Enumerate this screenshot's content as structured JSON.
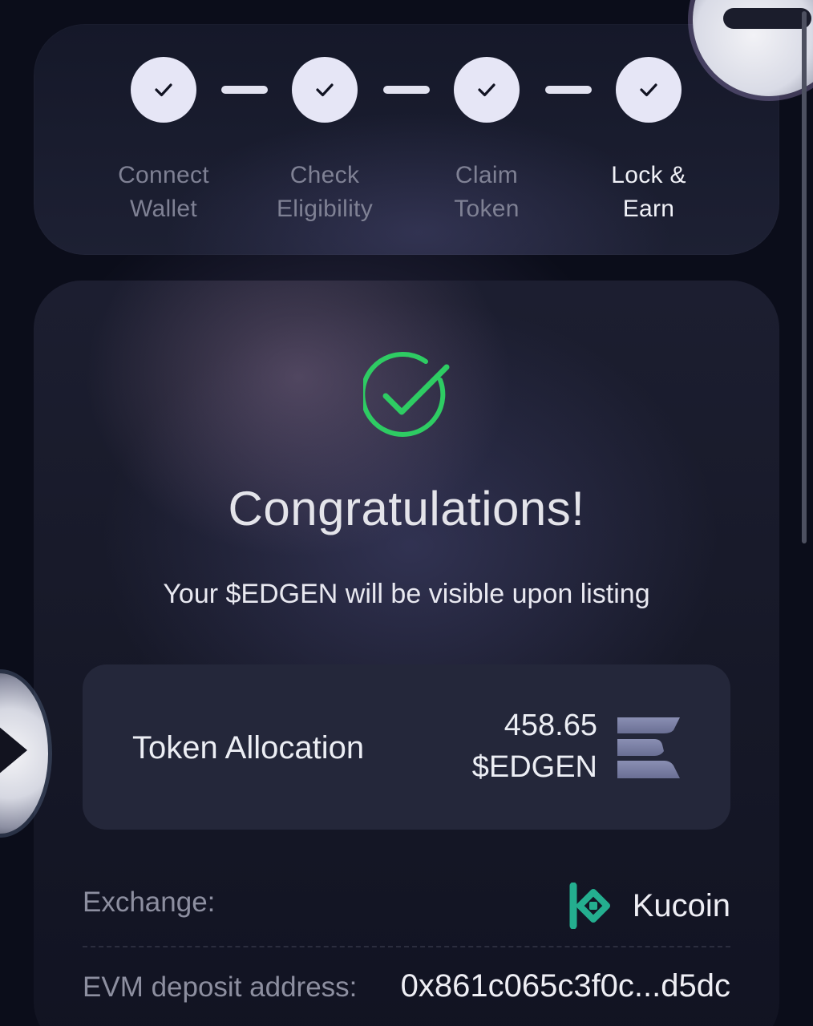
{
  "steps": [
    {
      "label": "Connect\nWallet",
      "icon": "checkmark-icon",
      "state": "complete"
    },
    {
      "label": "Check\nEligibility",
      "icon": "checkmark-icon",
      "state": "complete"
    },
    {
      "label": "Claim\nToken",
      "icon": "checkmark-icon",
      "state": "complete"
    },
    {
      "label": "Lock &\nEarn",
      "icon": "checkmark-icon",
      "state": "active"
    }
  ],
  "result": {
    "icon": "success-check-circle-icon",
    "title": "Congratulations!",
    "subtitle": "Your $EDGEN will be visible upon listing"
  },
  "allocation": {
    "label": "Token Allocation",
    "amount": "458.65",
    "symbol": "$EDGEN",
    "token_icon": "edgen-logo-icon"
  },
  "details": {
    "exchange_label": "Exchange:",
    "exchange_name": "Kucoin",
    "exchange_icon": "kucoin-logo-icon",
    "address_label": "EVM deposit address:",
    "address_value": "0x861c065c3f0c...d5dc"
  },
  "colors": {
    "background": "#0b0d1a",
    "success_green": "#2ecc63",
    "kucoin_teal": "#24ae8f",
    "step_circle": "#e6e6f6",
    "muted_text": "#7f8194"
  }
}
